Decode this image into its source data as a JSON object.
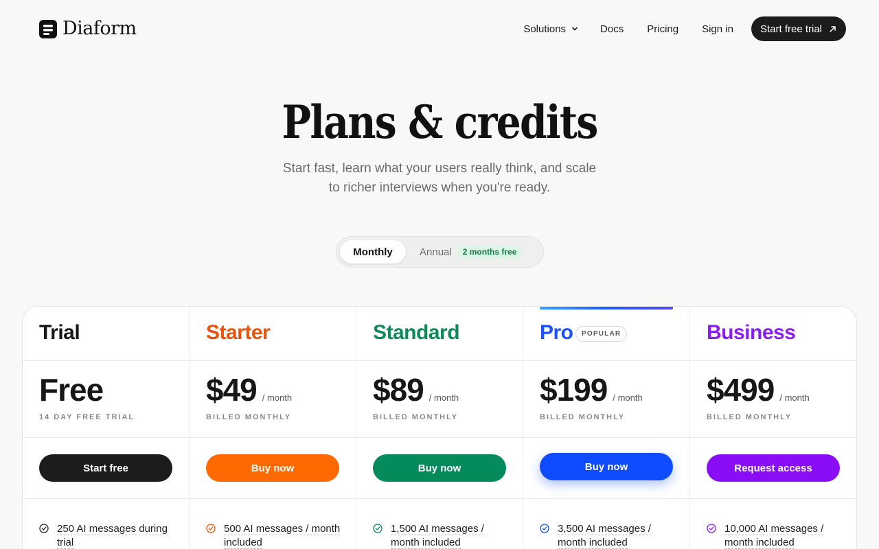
{
  "brand": {
    "name": "Diaform"
  },
  "nav": {
    "solutions": "Solutions",
    "docs": "Docs",
    "pricing": "Pricing",
    "signin": "Sign in",
    "cta": "Start free trial"
  },
  "hero": {
    "title": "Plans & credits",
    "subtitle": "Start fast, learn what your users really think, and scale to richer interviews when you're ready."
  },
  "billing_toggle": {
    "monthly": "Monthly",
    "annual": "Annual",
    "annual_badge": "2 months free",
    "selected": "Monthly"
  },
  "plans": [
    {
      "name": "Trial",
      "color": "#171717",
      "price": "Free",
      "per": "",
      "billing": "14 DAY FREE TRIAL",
      "button": "Start free",
      "button_color": "#1c1c1c",
      "feature": "250 AI messages during trial",
      "check_color": "#222222"
    },
    {
      "name": "Starter",
      "color": "#e8530e",
      "price": "$49",
      "per": "/ month",
      "billing": "BILLED MONTHLY",
      "button": "Buy now",
      "button_color": "#ff6a00",
      "feature": "500 AI messages / month included",
      "check_color": "#e8530e"
    },
    {
      "name": "Standard",
      "color": "#0e8a5a",
      "price": "$89",
      "per": "/ month",
      "billing": "BILLED MONTHLY",
      "button": "Buy now",
      "button_color": "#058a5c",
      "feature": "1,500 AI messages / month included",
      "check_color": "#0e8a5a"
    },
    {
      "name": "Pro",
      "badge": "POPULAR",
      "color": "#1f4fff",
      "price": "$199",
      "per": "/ month",
      "billing": "BILLED MONTHLY",
      "button": "Buy now",
      "button_color": "#0f4cff",
      "feature": "3,500 AI messages / month included",
      "check_color": "#1f4fff"
    },
    {
      "name": "Business",
      "color": "#8a1df0",
      "price": "$499",
      "per": "/ month",
      "billing": "BILLED MONTHLY",
      "button": "Request access",
      "button_color": "#8a0ef5",
      "feature": "10,000 AI messages / month included",
      "check_color": "#8a1df0"
    }
  ],
  "icons": {
    "brand": "document-stack-icon",
    "solutions": "chevron-down-icon",
    "cta": "arrow-up-right-icon",
    "feature": "check-circle-icon"
  }
}
